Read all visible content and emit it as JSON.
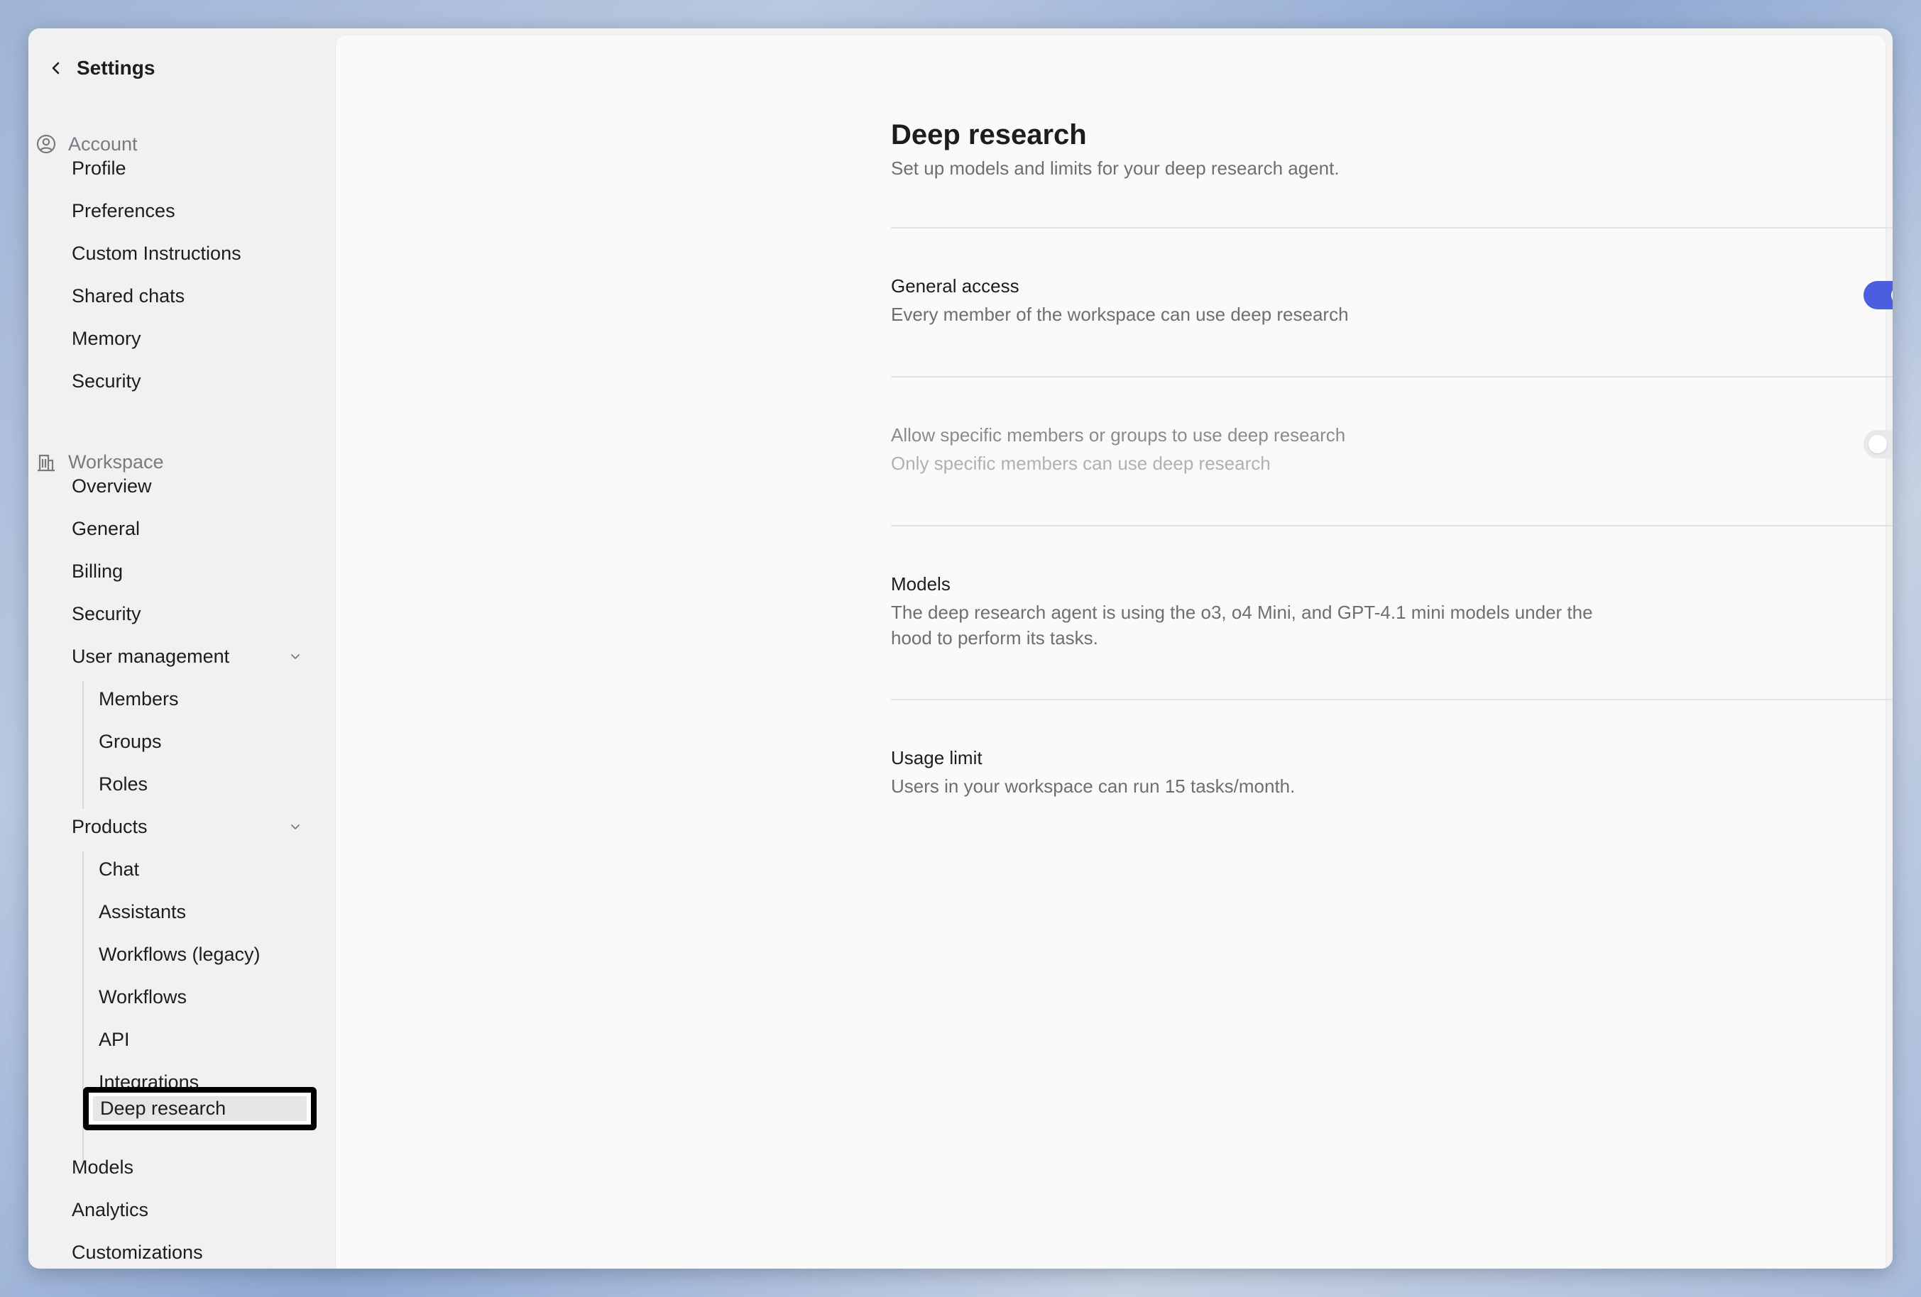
{
  "colors": {
    "accent": "#4a5fe0",
    "selected_outline": "#000000",
    "text_primary": "#1d1d1f",
    "text_secondary": "#6e6e73"
  },
  "sidebar": {
    "back_icon": "chevron-left-icon",
    "title": "Settings",
    "account": {
      "label": "Account",
      "icon": "user-circle-icon",
      "items": [
        "Profile",
        "Preferences",
        "Custom Instructions",
        "Shared chats",
        "Memory",
        "Security"
      ]
    },
    "workspace": {
      "label": "Workspace",
      "icon": "building-icon",
      "items": [
        "Overview",
        "General",
        "Billing",
        "Security"
      ],
      "user_management": {
        "label": "User management",
        "icon": "chevron-down-icon",
        "items": [
          "Members",
          "Groups",
          "Roles"
        ]
      },
      "products": {
        "label": "Products",
        "icon": "chevron-down-icon",
        "items": [
          "Chat",
          "Assistants",
          "Workflows (legacy)",
          "Workflows",
          "API",
          "Integrations",
          "Deep research"
        ],
        "selected": "Deep research"
      },
      "items_after": [
        "Models",
        "Analytics",
        "Customizations"
      ]
    }
  },
  "main": {
    "title": "Deep research",
    "subtitle": "Set up models and limits for your deep research agent.",
    "general_access": {
      "title": "General access",
      "description": "Every member of the workspace can use deep research",
      "enabled": true
    },
    "specific_members": {
      "title": "Allow specific members or groups to use deep research",
      "description": "Only specific members can use deep research",
      "enabled": false
    },
    "models": {
      "title": "Models",
      "description": "The deep research agent is using the o3, o4 Mini, and GPT-4.1 mini models under the hood to perform its tasks."
    },
    "usage_limit": {
      "title": "Usage limit",
      "description": "Users in your workspace can run 15 tasks/month."
    }
  }
}
